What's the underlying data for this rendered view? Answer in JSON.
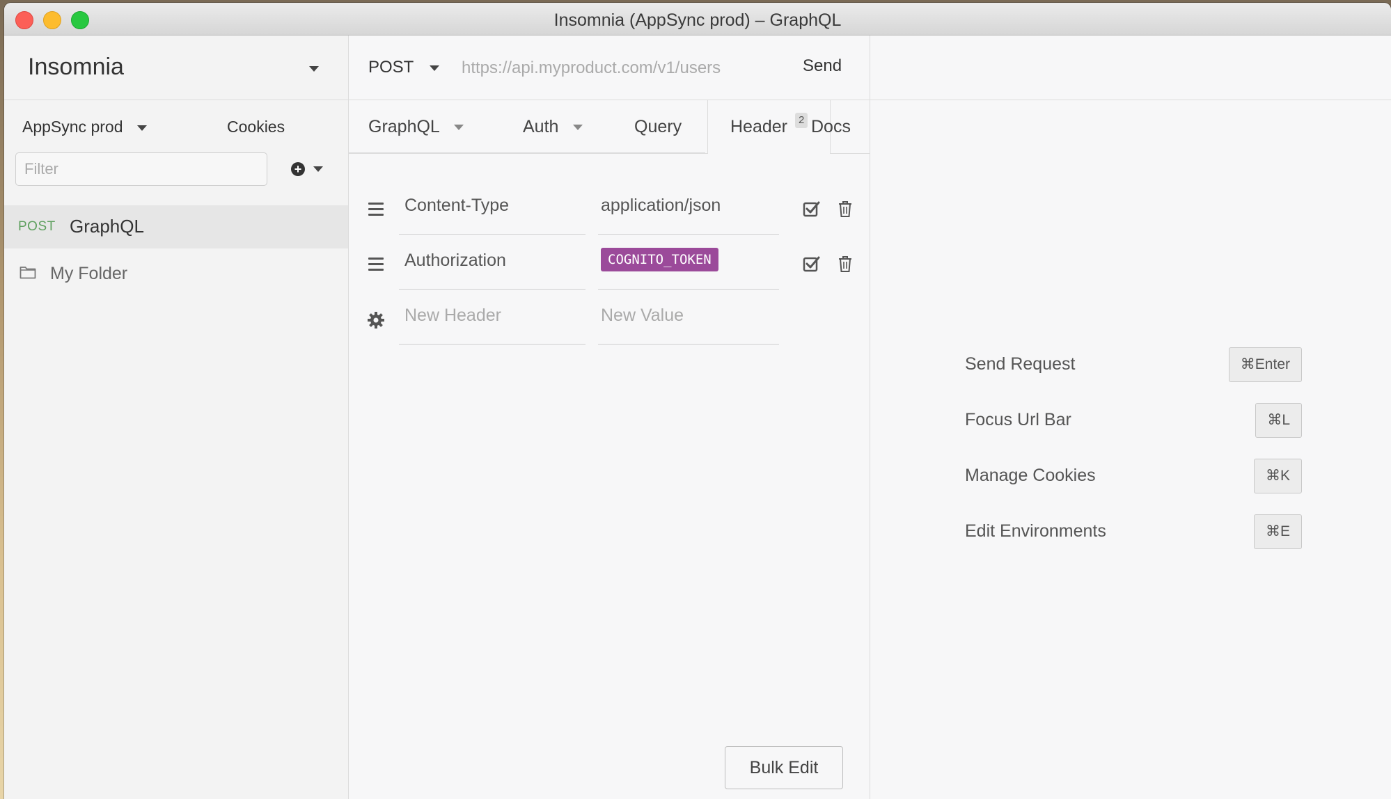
{
  "window": {
    "title": "Insomnia (AppSync prod) – GraphQL"
  },
  "sidebar": {
    "workspace": "Insomnia",
    "environment": "AppSync prod",
    "cookies_label": "Cookies",
    "filter_placeholder": "Filter",
    "items": [
      {
        "type": "request",
        "method": "POST",
        "name": "GraphQL"
      },
      {
        "type": "folder",
        "name": "My Folder"
      }
    ]
  },
  "request": {
    "method": "POST",
    "url_placeholder": "https://api.myproduct.com/v1/users",
    "send_label": "Send",
    "tabs": [
      {
        "label": "GraphQL"
      },
      {
        "label": "Auth"
      },
      {
        "label": "Query"
      },
      {
        "label": "Header",
        "badge": "2"
      },
      {
        "label": "Docs"
      }
    ],
    "headers": [
      {
        "name": "Content-Type",
        "value": "application/json"
      },
      {
        "name": "Authorization",
        "value": "COGNITO_TOKEN"
      }
    ],
    "new_header_placeholder": "New Header",
    "new_value_placeholder": "New Value",
    "bulk_edit_label": "Bulk Edit"
  },
  "response": {
    "shortcuts": [
      {
        "label": "Send Request",
        "key": "⌘Enter"
      },
      {
        "label": "Focus Url Bar",
        "key": "⌘L"
      },
      {
        "label": "Manage Cookies",
        "key": "⌘K"
      },
      {
        "label": "Edit Environments",
        "key": "⌘E"
      }
    ]
  },
  "colors": {
    "token_bg": "#9b4a9a",
    "post_method": "#5fa05f"
  }
}
